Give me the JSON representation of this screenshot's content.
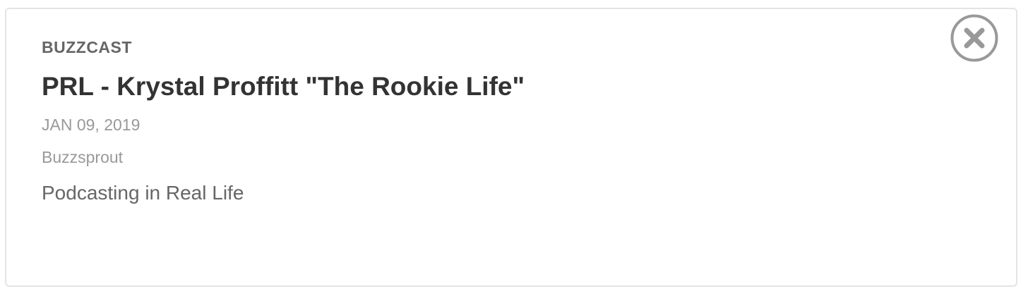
{
  "episode": {
    "podcast_name": "BUZZCAST",
    "title": "PRL - Krystal Proffitt \"The Rookie Life\"",
    "date": "JAN 09, 2019",
    "author": "Buzzsprout",
    "description": "Podcasting in Real Life"
  },
  "icons": {
    "close": "close-icon"
  },
  "colors": {
    "title": "#333333",
    "secondary": "#666666",
    "muted": "#999999",
    "close_icon": "#999999",
    "border": "#e4e4e4"
  }
}
